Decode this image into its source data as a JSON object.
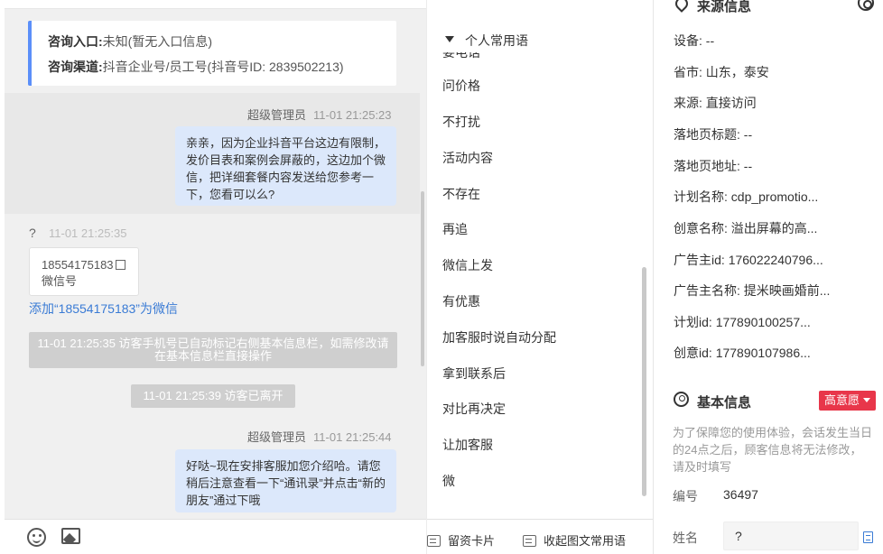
{
  "consult_card": {
    "entry_label": "咨询入口:",
    "entry_value": "未知(暂无入口信息)",
    "channel_label": "咨询渠道:",
    "channel_value": "抖音企业号/员工号(抖音号ID: 2839502213)"
  },
  "messages": [
    {
      "sender": "超级管理员",
      "time": "11-01 21:25:23",
      "text": "亲亲，因为企业抖音平台这边有限制，发价目表和案例会屏蔽的，这边加个微信，把详细套餐内容发送给您参考一下，您看可以么?"
    },
    {
      "sender": "?",
      "time": "11-01 21:25:35",
      "phone": "18554175183",
      "phone_caption": "微信号",
      "add_wechat_link": "添加“18554175183”为微信"
    },
    {
      "system_note": "11-01 21:25:35 访客手机号已自动标记右侧基本信息栏，如需修改请在基本信息栏直接操作"
    },
    {
      "system_note": "11-01 21:25:39 访客已离开"
    },
    {
      "sender": "超级管理员",
      "time": "11-01 21:25:44",
      "text": "好哒~现在安排客服加您介绍哈。请您稍后注意查看一下“通讯录”并点击“新的朋友”通过下哦"
    }
  ],
  "phrases": {
    "group_title": "个人常用语",
    "hidden_item": "要电话",
    "items": [
      "问价格",
      "不打扰",
      "活动内容",
      "不存在",
      "再追",
      "微信上发",
      "有优惠",
      "加客服时说自动分配",
      "拿到联系后",
      "对比再决定",
      "让加客服",
      "微"
    ],
    "toolbar": {
      "card_label": "留资卡片",
      "collapse_label": "收起图文常用语"
    }
  },
  "source_info": {
    "title": "来源信息",
    "fields": [
      {
        "label": "设备:",
        "value": "--"
      },
      {
        "label": "省市:",
        "value": "山东，泰安"
      },
      {
        "label": "来源:",
        "value": "直接访问"
      },
      {
        "label": "落地页标题:",
        "value": "--"
      },
      {
        "label": "落地页地址:",
        "value": "--"
      },
      {
        "label": "计划名称:",
        "value": "cdp_promotio..."
      },
      {
        "label": "创意名称:",
        "value": "溢出屏幕的高..."
      },
      {
        "label": "广告主id:",
        "value": "176022240796..."
      },
      {
        "label": "广告主名称:",
        "value": "提米映画婚前..."
      },
      {
        "label": "计划id:",
        "value": "177890100257..."
      },
      {
        "label": "创意id:",
        "value": "177890107986..."
      }
    ]
  },
  "basic_info": {
    "title": "基本信息",
    "intent_badge": "高意愿",
    "notice": "为了保障您的使用体验，会话发生当日的24点之后，顾客信息将无法修改，请及时填写",
    "id_label": "编号",
    "id_value": "36497",
    "name_label": "姓名",
    "name_value": "?"
  },
  "colors": {
    "accent_blue": "#3a7bd5",
    "bubble_blue": "#dce8fb",
    "badge_red": "#e8364a",
    "card_border": "#5b8ff9"
  }
}
